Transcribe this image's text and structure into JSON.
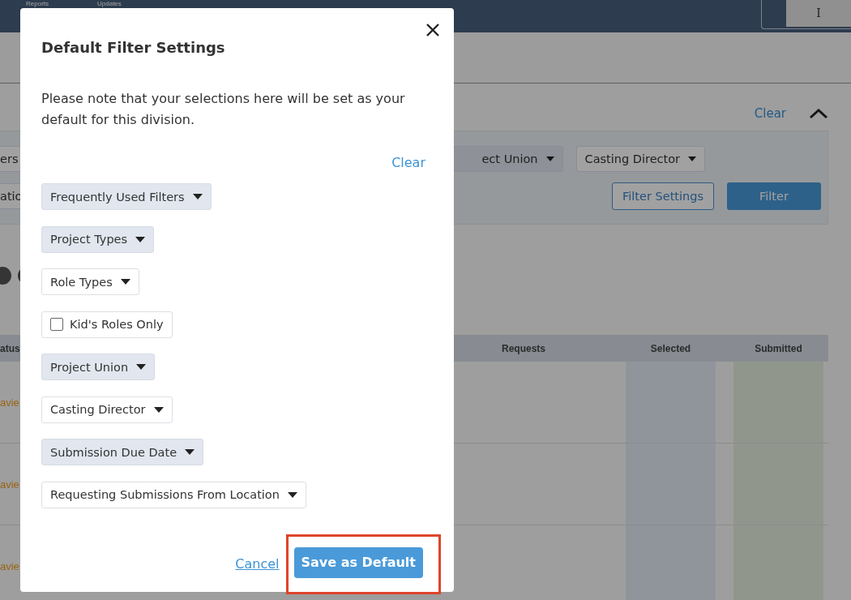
{
  "background_page": {
    "nav_items": [
      "Reports",
      "Updates"
    ],
    "account_button": "I",
    "filter_header": {
      "clear": "Clear"
    },
    "filter_row_1": [
      "ers",
      "ect Union",
      "Casting Director"
    ],
    "filter_row_2": [
      "atio"
    ],
    "filter_settings_button": "Filter Settings",
    "filter_button": "Filter",
    "table": {
      "columns": [
        "atus",
        "Requests",
        "Selected",
        "Submitted"
      ],
      "rows": [
        {
          "column_1": "avie"
        },
        {
          "column_1": "avie"
        },
        {
          "column_1": "avie"
        }
      ]
    }
  },
  "dialog": {
    "title": "Default Filter Settings",
    "message": "Please note that your selections here will be set as your default for this division.",
    "clear": "Clear",
    "filters": [
      {
        "kind": "dropdown",
        "label": "Frequently Used Filters",
        "active": true
      },
      {
        "kind": "dropdown",
        "label": "Project Types",
        "active": true
      },
      {
        "kind": "dropdown",
        "label": "Role Types",
        "active": false
      },
      {
        "kind": "checkbox",
        "label": "Kid's Roles Only",
        "checked": false
      },
      {
        "kind": "dropdown",
        "label": "Project Union",
        "active": true
      },
      {
        "kind": "dropdown",
        "label": "Casting Director",
        "active": false
      },
      {
        "kind": "dropdown",
        "label": "Submission Due Date",
        "active": true
      },
      {
        "kind": "dropdown",
        "label": "Requesting Submissions From Location",
        "active": false
      }
    ],
    "cancel": "Cancel",
    "save": {
      "label": "Save as Default",
      "highlighted": true
    }
  }
}
